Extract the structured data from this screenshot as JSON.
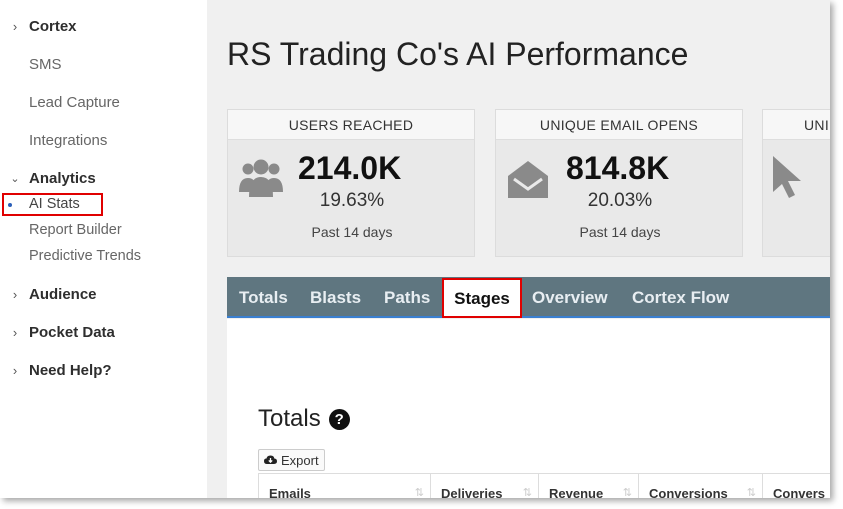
{
  "sidebar": {
    "groups": [
      {
        "label": "Cortex",
        "expanded": false
      },
      {
        "label": "Analytics",
        "expanded": true
      },
      {
        "label": "Audience",
        "expanded": false
      },
      {
        "label": "Pocket Data",
        "expanded": false
      },
      {
        "label": "Need Help?",
        "expanded": false
      }
    ],
    "cortex_items": [
      "SMS",
      "Lead Capture",
      "Integrations"
    ],
    "analytics_items": [
      "AI Stats",
      "Report Builder",
      "Predictive Trends"
    ],
    "active_item": "AI Stats",
    "accent_color": "#2b5fb8"
  },
  "main": {
    "title": "RS Trading Co's AI Performance",
    "cards": [
      {
        "header": "USERS REACHED",
        "value": "214.0K",
        "percent": "19.63%",
        "period": "Past 14 days",
        "icon": "users-icon"
      },
      {
        "header": "UNIQUE EMAIL OPENS",
        "value": "814.8K",
        "percent": "20.03%",
        "period": "Past 14 days",
        "icon": "envelope-open-icon"
      },
      {
        "header": "UNI",
        "icon": "cursor-icon"
      }
    ],
    "tabs": [
      "Totals",
      "Blasts",
      "Paths",
      "Stages",
      "Overview",
      "Cortex Flow"
    ],
    "active_tab": "Stages",
    "section_title": "Totals",
    "export_label": "Export",
    "table_headers": [
      "Emails",
      "Deliveries",
      "Revenue",
      "Conversions",
      "Convers"
    ]
  },
  "highlight_color": "#e00000"
}
